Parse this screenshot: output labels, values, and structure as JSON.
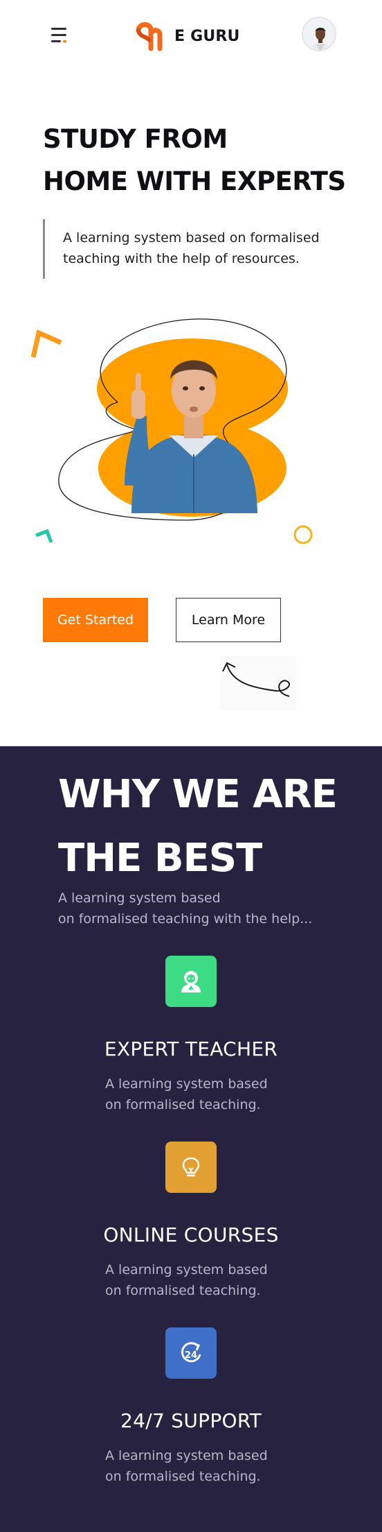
{
  "header": {
    "brand": "E GURU"
  },
  "hero": {
    "title_line1": "STUDY FROM",
    "title_line2": "HOME WITH EXPERTS",
    "description": "A learning system based on formalised teaching with the help of resources.",
    "primary_button": "Get Started",
    "secondary_button": "Learn More"
  },
  "why": {
    "title_line1": "WHY WE ARE",
    "title_line2": "THE BEST",
    "desc_line1": "A learning system based",
    "desc_line2": "on formalised teaching with the help...",
    "features": [
      {
        "title": "EXPERT TEACHER",
        "desc_line1": "A learning system based",
        "desc_line2": "on formalised teaching.",
        "icon": "teacher-icon",
        "color": "#3ddc84"
      },
      {
        "title": "ONLINE COURSES",
        "desc_line1": "A learning system based",
        "desc_line2": "on formalised teaching.",
        "icon": "lightbulb-icon",
        "color": "#e2a033"
      },
      {
        "title": "24/7 SUPPORT",
        "desc_line1": "A learning system based",
        "desc_line2": "on formalised teaching.",
        "icon": "support-24-icon",
        "color": "#3f6fc6"
      }
    ]
  },
  "colors": {
    "accent": "#ff7a08",
    "hero_blob": "#ffa000",
    "section_bg": "#262240"
  }
}
